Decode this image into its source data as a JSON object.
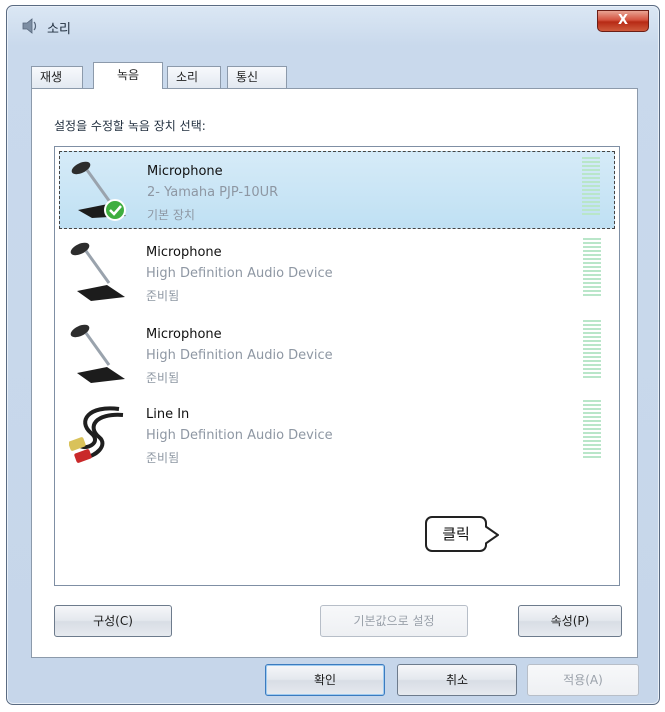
{
  "window": {
    "title": "소리",
    "close_label": "X"
  },
  "tabs": [
    {
      "label": "재생",
      "active": false
    },
    {
      "label": "녹음",
      "active": true
    },
    {
      "label": "소리",
      "active": false
    },
    {
      "label": "통신",
      "active": false
    }
  ],
  "instruction": "설정을 수정할 녹음 장치 선택:",
  "devices": [
    {
      "name": "Microphone",
      "description": "2- Yamaha PJP-10UR",
      "status": "기본 장치",
      "icon": "microphone-default-icon",
      "selected": true
    },
    {
      "name": "Microphone",
      "description": "High Definition Audio Device",
      "status": "준비됨",
      "icon": "microphone-icon",
      "selected": false
    },
    {
      "name": "Microphone",
      "description": "High Definition Audio Device",
      "status": "준비됨",
      "icon": "microphone-icon",
      "selected": false
    },
    {
      "name": "Line In",
      "description": "High Definition Audio Device",
      "status": "준비됨",
      "icon": "rca-cable-icon",
      "selected": false
    }
  ],
  "buttons": {
    "configure": "구성(C)",
    "set_default": "기본값으로 설정",
    "properties": "속성(P)",
    "ok": "확인",
    "cancel": "취소",
    "apply": "적용(A)"
  },
  "callout": "클릭",
  "colors": {
    "selection": "#bfe0f3",
    "meter": "#b9e6c9",
    "close": "#c93b22"
  }
}
